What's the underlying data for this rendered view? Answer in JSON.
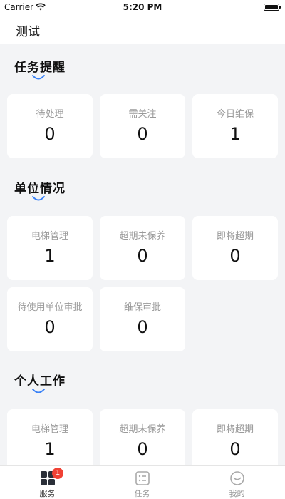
{
  "status_bar": {
    "carrier": "Carrier",
    "time": "5:20 PM"
  },
  "nav": {
    "title": "测试"
  },
  "sections": {
    "tasks": {
      "title": "任务提醒",
      "cards": [
        {
          "label": "待处理",
          "value": "0"
        },
        {
          "label": "需关注",
          "value": "0"
        },
        {
          "label": "今日维保",
          "value": "1"
        }
      ]
    },
    "unit": {
      "title": "单位情况",
      "cards": [
        {
          "label": "电梯管理",
          "value": "1"
        },
        {
          "label": "超期未保养",
          "value": "0"
        },
        {
          "label": "即将超期",
          "value": "0"
        },
        {
          "label": "待使用单位审批",
          "value": "0"
        },
        {
          "label": "维保审批",
          "value": "0"
        }
      ]
    },
    "personal": {
      "title": "个人工作",
      "cards": [
        {
          "label": "电梯管理",
          "value": "1"
        },
        {
          "label": "超期未保养",
          "value": "0"
        },
        {
          "label": "即将超期",
          "value": "0"
        }
      ]
    }
  },
  "tab_bar": {
    "tabs": [
      {
        "label": "服务",
        "icon": "grid-icon",
        "badge": "1"
      },
      {
        "label": "任务",
        "icon": "list-icon"
      },
      {
        "label": "我的",
        "icon": "profile-icon"
      }
    ]
  },
  "colors": {
    "accent": "#3b82f6",
    "badge": "#f04134",
    "background": "#f3f4f6"
  }
}
